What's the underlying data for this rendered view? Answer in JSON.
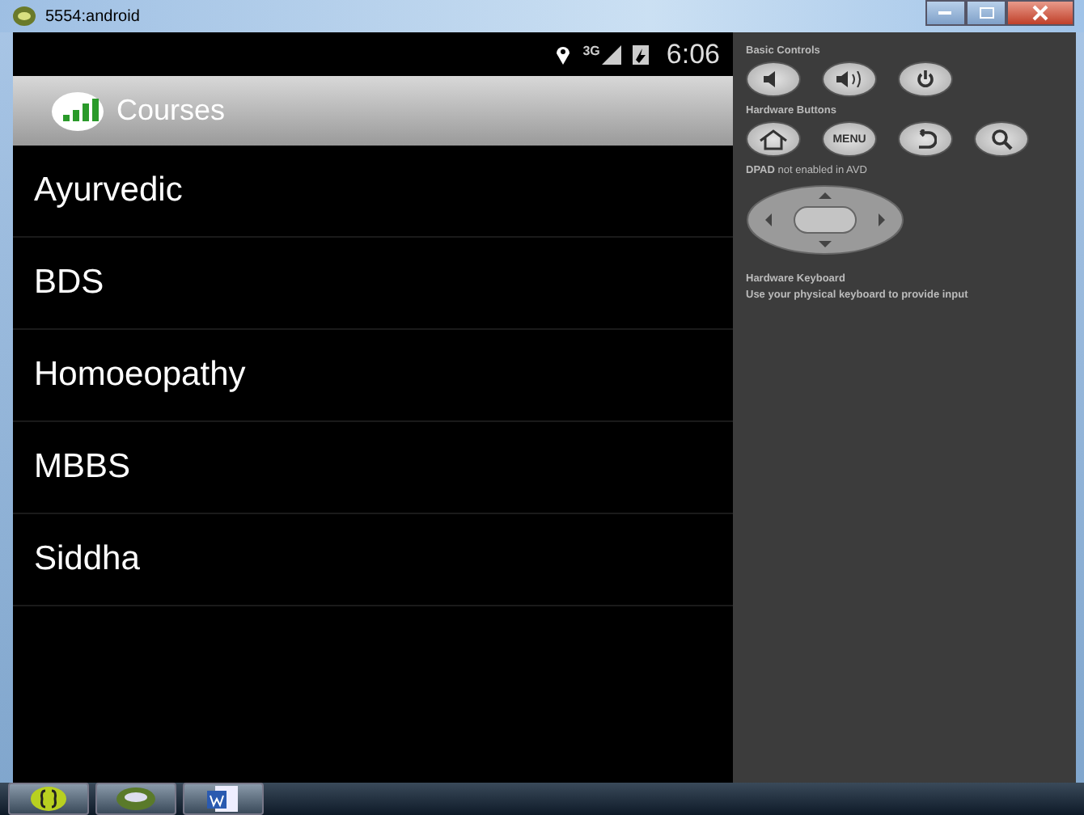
{
  "window": {
    "title": "5554:android"
  },
  "status_bar": {
    "network": "3G",
    "time": "6:06"
  },
  "action_bar": {
    "title": "Courses"
  },
  "courses": [
    {
      "label": "Ayurvedic"
    },
    {
      "label": "BDS"
    },
    {
      "label": "Homoeopathy"
    },
    {
      "label": "MBBS"
    },
    {
      "label": "Siddha"
    }
  ],
  "controls": {
    "basic_title": "Basic Controls",
    "hardware_title": "Hardware Buttons",
    "menu_label": "MENU",
    "dpad_title": "**DPAD** not enabled in AVD",
    "keyboard_title": "Hardware Keyboard",
    "keyboard_text": "Use your physical keyboard to provide input"
  }
}
